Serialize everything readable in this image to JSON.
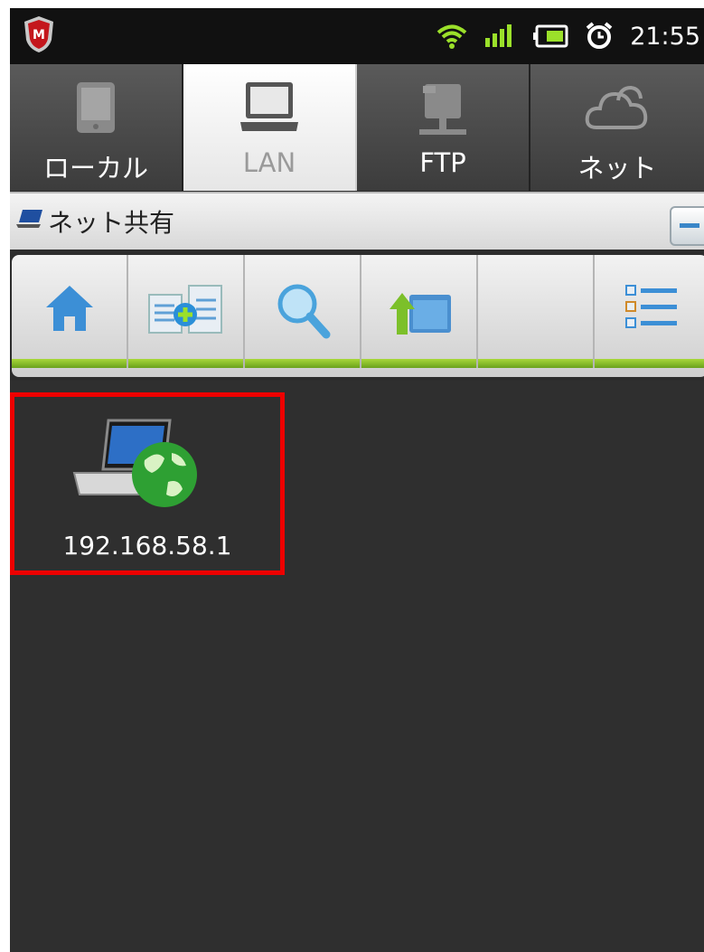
{
  "status_bar": {
    "time": "21:55",
    "icons": [
      "mcafee-shield-icon",
      "wifi-icon",
      "signal-icon",
      "battery-icon",
      "alarm-icon"
    ]
  },
  "tabs": [
    {
      "label": "ローカル",
      "icon": "tablet-icon",
      "active": false
    },
    {
      "label": "LAN",
      "icon": "laptop-icon",
      "active": true
    },
    {
      "label": "FTP",
      "icon": "server-icon",
      "active": false
    },
    {
      "label": "ネット",
      "icon": "cloud-icon",
      "active": false
    }
  ],
  "path_bar": {
    "label": "ネット共有",
    "icon": "network-share-icon"
  },
  "toolbar": {
    "buttons": [
      "home-icon",
      "new-folder-icon",
      "search-icon",
      "up-folder-icon",
      "",
      "view-list-icon"
    ]
  },
  "content": {
    "items": [
      {
        "label": "192.168.58.1",
        "icon": "network-computer-icon"
      }
    ]
  },
  "colors": {
    "background": "#2d2d2d",
    "highlight": "#ee0000",
    "toolbar_accent": "#8cc43a"
  }
}
